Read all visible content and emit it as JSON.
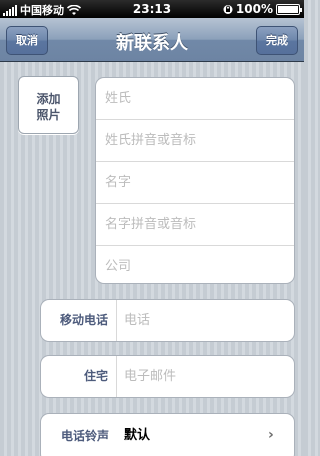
{
  "status_bar": {
    "carrier": "中国移动",
    "time": "23:13",
    "battery": "100%",
    "battery_level": 100
  },
  "nav": {
    "title": "新联系人",
    "cancel_label": "取消",
    "done_label": "完成"
  },
  "photo": {
    "label_line1": "添加",
    "label_line2": "照片"
  },
  "name_fields": [
    {
      "placeholder": "姓氏"
    },
    {
      "placeholder": "姓氏拼音或音标"
    },
    {
      "placeholder": "名字"
    },
    {
      "placeholder": "名字拼音或音标"
    },
    {
      "placeholder": "公司"
    }
  ],
  "mobile": {
    "label": "移动电话",
    "placeholder": "电话"
  },
  "home": {
    "label": "住宅",
    "placeholder": "电子邮件"
  },
  "ringtone": {
    "label": "电话铃声",
    "value": "默认"
  },
  "icons": {
    "signal": "signal-bars-icon",
    "wifi": "wifi-icon",
    "lock": "rotation-lock-icon",
    "battery": "battery-icon",
    "chevron": "chevron-right-icon"
  }
}
